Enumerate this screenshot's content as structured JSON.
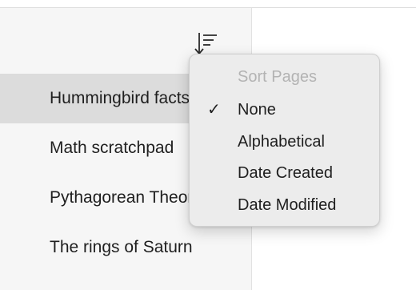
{
  "sidebar": {
    "pages": [
      {
        "title": "Hummingbird facts",
        "selected": true
      },
      {
        "title": "Math scratchpad",
        "selected": false
      },
      {
        "title": "Pythagorean Theorem",
        "selected": false
      },
      {
        "title": "The rings of Saturn",
        "selected": false
      }
    ]
  },
  "sort_menu": {
    "header": "Sort Pages",
    "check_glyph": "✓",
    "options": [
      {
        "label": "None",
        "checked": true
      },
      {
        "label": "Alphabetical",
        "checked": false
      },
      {
        "label": "Date Created",
        "checked": false
      },
      {
        "label": "Date Modified",
        "checked": false
      }
    ]
  },
  "icons": {
    "sort_button": "sort-icon"
  },
  "colors": {
    "sidebar_bg": "#f6f6f6",
    "selected_row": "#dcdcdc",
    "menu_bg": "#ececec"
  }
}
